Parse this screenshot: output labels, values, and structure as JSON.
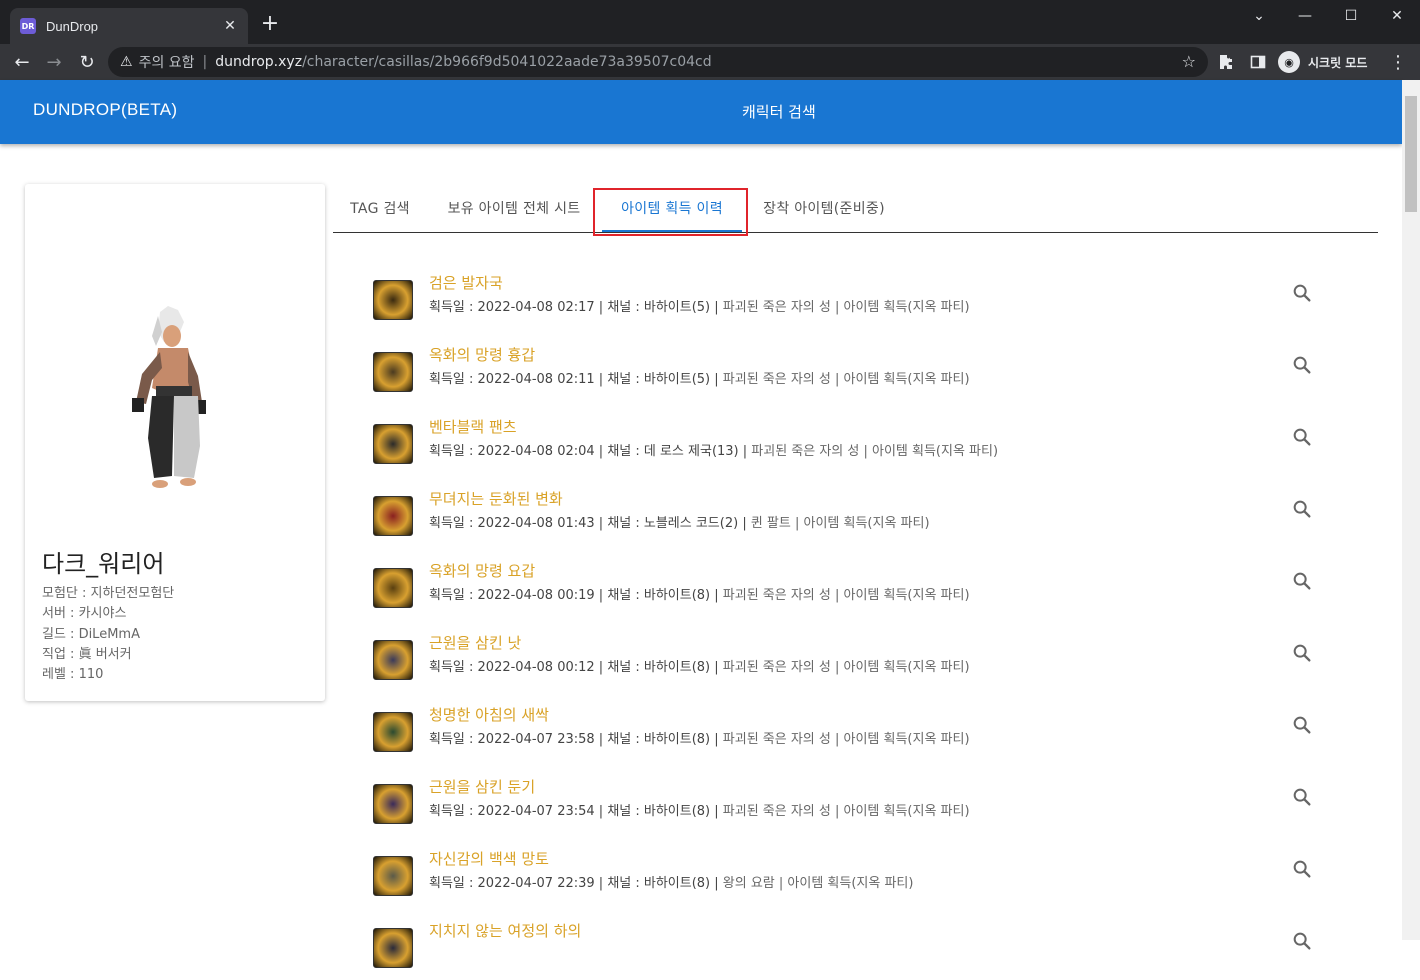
{
  "browser": {
    "tab_title": "DunDrop",
    "favicon_text": "DR",
    "warning_label": "주의 요함",
    "url_host": "dundrop.xyz",
    "url_path": "/character/casillas/2b966f9d5041022aade73a39507c04cd",
    "incognito_label": "시크릿 모드"
  },
  "app": {
    "brand": "DUNDROP(BETA)",
    "header_title": "캐릭터 검색"
  },
  "character": {
    "name": "다크_워리어",
    "adventure": "모험단 : 지하던전모험단",
    "server": "서버 : 카시야스",
    "guild": "길드 : DiLeMmA",
    "job": "직업 : 眞 버서커",
    "level": "레벨 : 110"
  },
  "tabs": [
    {
      "label": "TAG 검색"
    },
    {
      "label": "보유 아이템 전체 시트"
    },
    {
      "label": "아이템 획득 이력"
    },
    {
      "label": "장착 아이템(준비중)"
    }
  ],
  "items": [
    {
      "name": "검은 발자국",
      "detail": "획득일 : 2022-04-08 02:17 | 채널 : 바하이트(5) | ",
      "place": "파괴된 죽은 자의 성 | 아이템 획득(지옥 파티)",
      "color": "#3a2a10"
    },
    {
      "name": "옥화의 망령 흉갑",
      "detail": "획득일 : 2022-04-08 02:11 | 채널 : 바하이트(5) | ",
      "place": "파괴된 죽은 자의 성 | 아이템 획득(지옥 파티)",
      "color": "#4a3a20"
    },
    {
      "name": "벤타블랙 팬츠",
      "detail": "획득일 : 2022-04-08 02:04 | 채널 : 데 로스 제국(13) | ",
      "place": "파괴된 죽은 자의 성 | 아이템 획득(지옥 파티)",
      "color": "#2a2a2a"
    },
    {
      "name": "무뎌지는 둔화된 변화",
      "detail": "획득일 : 2022-04-08 01:43 | 채널 : 노블레스 코드(2) | ",
      "place": "퀸 팔트 | 아이템 획득(지옥 파티)",
      "color": "#8a2020"
    },
    {
      "name": "옥화의 망령 요갑",
      "detail": "획득일 : 2022-04-08 00:19 | 채널 : 바하이트(8) | ",
      "place": "파괴된 죽은 자의 성 | 아이템 획득(지옥 파티)",
      "color": "#5a4010"
    },
    {
      "name": "근원을 삼킨 낫",
      "detail": "획득일 : 2022-04-08 00:12 | 채널 : 바하이트(8) | ",
      "place": "파괴된 죽은 자의 성 | 아이템 획득(지옥 파티)",
      "color": "#3a3a5a"
    },
    {
      "name": "청명한 아침의 새싹",
      "detail": "획득일 : 2022-04-07 23:58 | 채널 : 바하이트(8) | ",
      "place": "파괴된 죽은 자의 성 | 아이템 획득(지옥 파티)",
      "color": "#2a4a30"
    },
    {
      "name": "근원을 삼킨 둔기",
      "detail": "획득일 : 2022-04-07 23:54 | 채널 : 바하이트(8) | ",
      "place": "파괴된 죽은 자의 성 | 아이템 획득(지옥 파티)",
      "color": "#3a2a5a"
    },
    {
      "name": "자신감의 백색 망토",
      "detail": "획득일 : 2022-04-07 22:39 | 채널 : 바하이트(8) | ",
      "place": "왕의 요람 | 아이템 획득(지옥 파티)",
      "color": "#5a5a4a"
    },
    {
      "name": "지치지 않는 여정의 하의",
      "detail": "",
      "place": "",
      "color": "#2a2a3a"
    }
  ]
}
